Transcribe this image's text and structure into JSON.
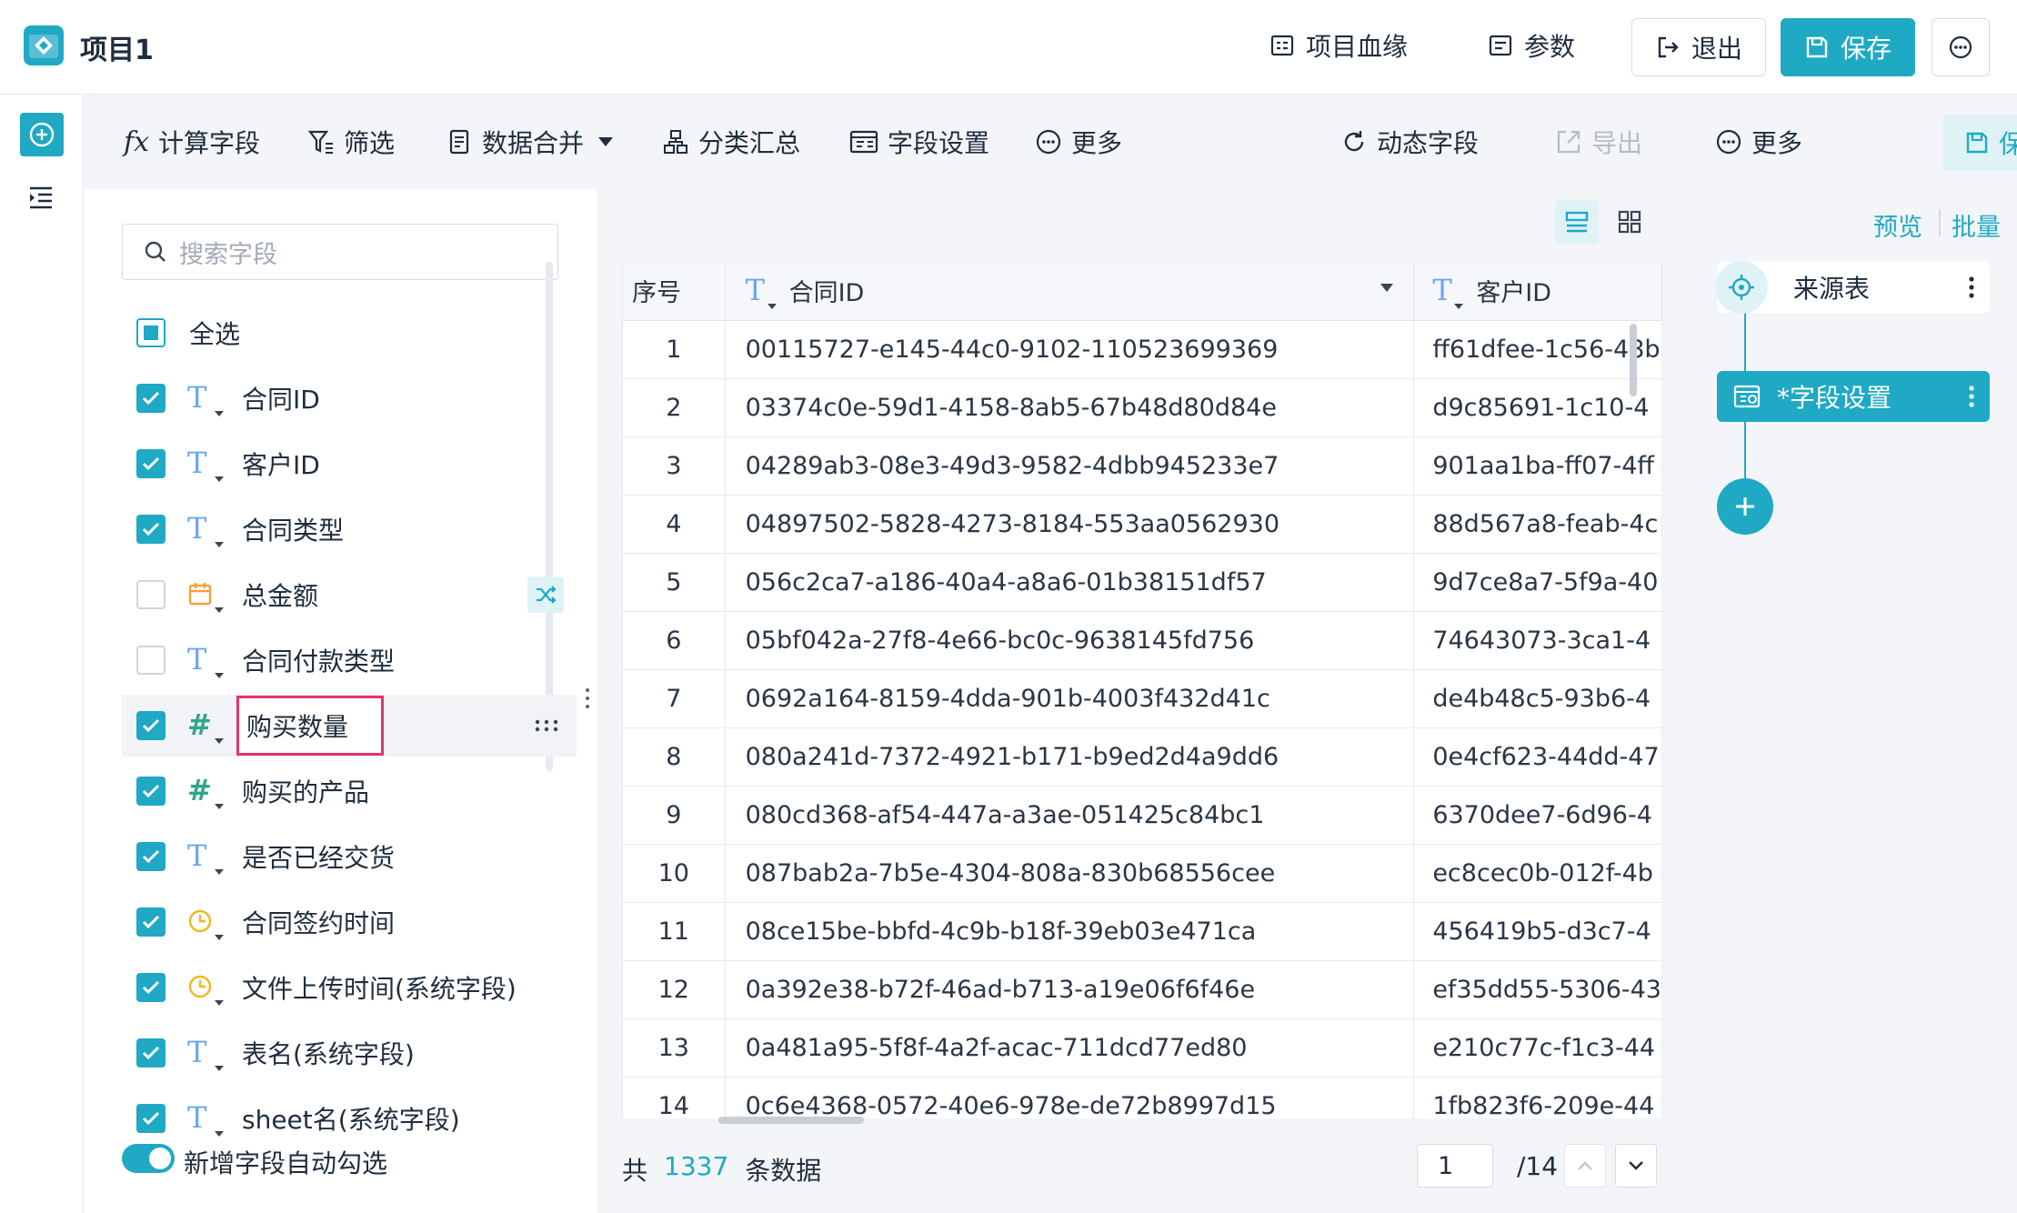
{
  "header": {
    "title": "项目1",
    "lineage": "项目血缘",
    "params": "参数",
    "exit": "退出",
    "save": "保存"
  },
  "toolbar": {
    "calc_field": "计算字段",
    "filter": "筛选",
    "merge": "数据合并",
    "group": "分类汇总",
    "field_settings": "字段设置",
    "more": "更多",
    "dynamic_field": "动态字段",
    "export": "导出",
    "more2": "更多",
    "save": "保存"
  },
  "fields": {
    "search_placeholder": "搜索字段",
    "select_all": "全选",
    "items": [
      {
        "type": "text",
        "name": "合同ID",
        "checked": true
      },
      {
        "type": "text",
        "name": "客户ID",
        "checked": true
      },
      {
        "type": "text",
        "name": "合同类型",
        "checked": true
      },
      {
        "type": "date",
        "name": "总金额",
        "checked": false
      },
      {
        "type": "text",
        "name": "合同付款类型",
        "checked": false
      },
      {
        "type": "number",
        "name": "购买数量",
        "checked": true
      },
      {
        "type": "number",
        "name": "购买的产品",
        "checked": true
      },
      {
        "type": "text",
        "name": "是否已经交货",
        "checked": true
      },
      {
        "type": "time",
        "name": "合同签约时间",
        "checked": true
      },
      {
        "type": "time",
        "name": "文件上传时间(系统字段)",
        "checked": true
      },
      {
        "type": "text",
        "name": "表名(系统字段)",
        "checked": true
      },
      {
        "type": "text",
        "name": "sheet名(系统字段)",
        "checked": true
      }
    ],
    "auto_check_label": "新增字段自动勾选"
  },
  "table": {
    "headers": [
      "序号",
      "合同ID",
      "客户ID"
    ],
    "rows": [
      [
        "1",
        "00115727-e145-44c0-9102-110523699369",
        "ff61dfee-1c56-48b"
      ],
      [
        "2",
        "03374c0e-59d1-4158-8ab5-67b48d80d84e",
        "d9c85691-1c10-4"
      ],
      [
        "3",
        "04289ab3-08e3-49d3-9582-4dbb945233e7",
        "901aa1ba-ff07-4ff"
      ],
      [
        "4",
        "04897502-5828-4273-8184-553aa0562930",
        "88d567a8-feab-4c"
      ],
      [
        "5",
        "056c2ca7-a186-40a4-a8a6-01b38151df57",
        "9d7ce8a7-5f9a-40"
      ],
      [
        "6",
        "05bf042a-27f8-4e66-bc0c-9638145fd756",
        "74643073-3ca1-4"
      ],
      [
        "7",
        "0692a164-8159-4dda-901b-4003f432d41c",
        "de4b48c5-93b6-4"
      ],
      [
        "8",
        "080a241d-7372-4921-b171-b9ed2d4a9dd6",
        "0e4cf623-44dd-47"
      ],
      [
        "9",
        "080cd368-af54-447a-a3ae-051425c84bc1",
        "6370dee7-6d96-4"
      ],
      [
        "10",
        "087bab2a-7b5e-4304-808a-830b68556cee",
        "ec8cec0b-012f-4b"
      ],
      [
        "11",
        "08ce15be-bbfd-4c9b-b18f-39eb03e471ca",
        "456419b5-d3c7-4"
      ],
      [
        "12",
        "0a392e38-b72f-46ad-b713-a19e06f6f46e",
        "ef35dd55-5306-43"
      ],
      [
        "13",
        "0a481a95-5f8f-4a2f-acac-711dcd77ed80",
        "e210c77c-f1c3-44"
      ],
      [
        "14",
        "0c6e4368-0572-40e6-978e-de72b8997d15",
        "1fb823f6-209e-44"
      ]
    ]
  },
  "footer": {
    "total_prefix": "共",
    "total_count": "1337",
    "total_suffix": "条数据",
    "page_value": "1",
    "page_total": "/14"
  },
  "pipeline": {
    "preview": "预览",
    "batch": "批量",
    "source_node": "来源表",
    "field_node": "*字段设置"
  },
  "colors": {
    "accent": "#1fa9c4",
    "highlight_box": "#e0356e"
  }
}
